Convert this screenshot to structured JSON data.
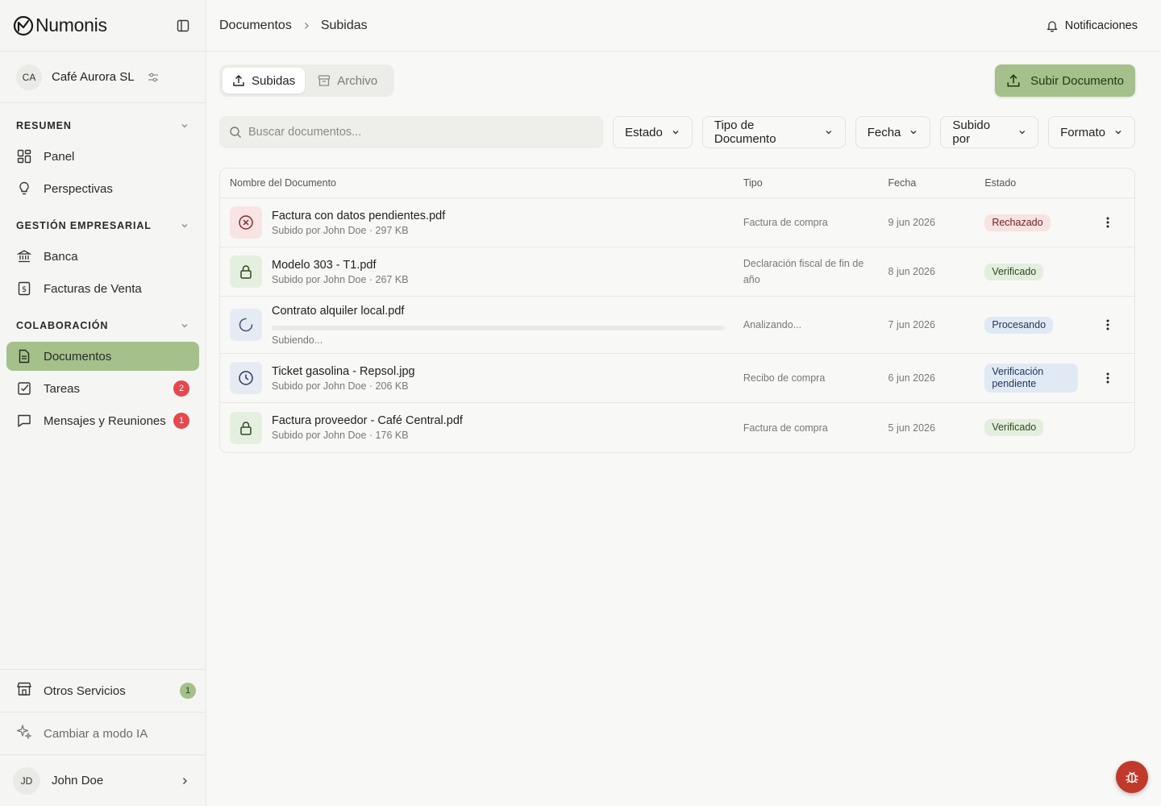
{
  "app": {
    "brand": "Numonis"
  },
  "company": {
    "initials": "CA",
    "name": "Café Aurora SL"
  },
  "sidebar": {
    "sections": [
      {
        "title": "RESUMEN",
        "items": [
          {
            "label": "Panel",
            "icon": "dashboard-icon"
          },
          {
            "label": "Perspectivas",
            "icon": "lightbulb-icon"
          }
        ]
      },
      {
        "title": "GESTIÓN EMPRESARIAL",
        "items": [
          {
            "label": "Banca",
            "icon": "bank-icon"
          },
          {
            "label": "Facturas de Venta",
            "icon": "invoice-icon"
          }
        ]
      },
      {
        "title": "COLABORACIÓN",
        "items": [
          {
            "label": "Documentos",
            "icon": "document-icon",
            "active": true
          },
          {
            "label": "Tareas",
            "icon": "checkbox-icon",
            "badge": "2"
          },
          {
            "label": "Mensajes y Reuniones",
            "icon": "message-icon",
            "badge": "1"
          }
        ]
      }
    ],
    "bottom": {
      "services_label": "Otros Servicios",
      "services_badge": "1",
      "ai_label": "Cambiar a modo IA",
      "user_initials": "JD",
      "user_name": "John Doe"
    }
  },
  "topbar": {
    "breadcrumb": [
      "Documentos",
      "Subidas"
    ],
    "notifications_label": "Notificaciones"
  },
  "tabs": [
    {
      "label": "Subidas",
      "active": true
    },
    {
      "label": "Archivo",
      "active": false
    }
  ],
  "upload_button_label": "Subir Documento",
  "search": {
    "placeholder": "Buscar documentos..."
  },
  "filters": [
    "Estado",
    "Tipo de Documento",
    "Fecha",
    "Subido por",
    "Formato"
  ],
  "table": {
    "headers": [
      "Nombre del Documento",
      "Tipo",
      "Fecha",
      "Estado"
    ],
    "rows": [
      {
        "name": "Factura con datos pendientes.pdf",
        "sub": "Subido por John Doe · 297 KB",
        "type": "Factura de compra",
        "date": "9 jun 2026",
        "status": "Rechazado",
        "tone": "red",
        "icon": "reject-icon",
        "menu": true
      },
      {
        "name": "Modelo 303 - T1.pdf",
        "sub": "Subido por John Doe · 267 KB",
        "type": "Declaración fiscal de fin de año",
        "date": "8 jun 2026",
        "status": "Verificado",
        "tone": "green",
        "icon": "lock-icon",
        "menu": false
      },
      {
        "name": "Contrato alquiler local.pdf",
        "sub": "Subiendo...",
        "type": "Analizando...",
        "date": "7 jun 2026",
        "status": "Procesando",
        "tone": "blue",
        "icon": "spinner-icon",
        "menu": true,
        "progress": 0.0
      },
      {
        "name": "Ticket gasolina - Repsol.jpg",
        "sub": "Subido por John Doe · 206 KB",
        "type": "Recibo de compra",
        "date": "6 jun 2026",
        "status": "Verificación pendiente",
        "tone": "blue",
        "icon": "clock-icon",
        "menu": true
      },
      {
        "name": "Factura proveedor - Café Central.pdf",
        "sub": "Subido por John Doe · 176 KB",
        "type": "Factura de compra",
        "date": "5 jun 2026",
        "status": "Verificado",
        "tone": "green",
        "icon": "lock-icon",
        "menu": false
      }
    ]
  },
  "colors": {
    "accent": "#a5c08a",
    "danger": "#e5484d",
    "bug_button": "#c0392b"
  }
}
